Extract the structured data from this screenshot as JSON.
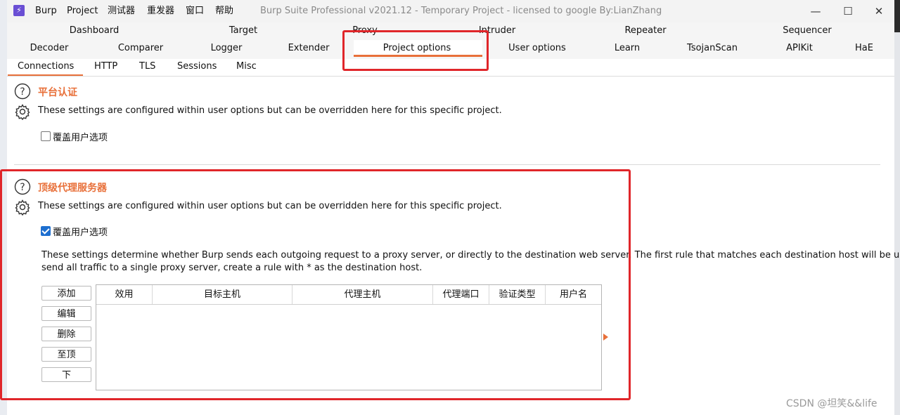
{
  "window": {
    "app_icon_glyph": "⚡",
    "menu": [
      "Burp",
      "Project",
      "测试器",
      "重发器",
      "窗口",
      "帮助"
    ],
    "title": "Burp Suite Professional v2021.12 - Temporary Project - licensed to google By:LianZhang",
    "controls": {
      "minimize": "—",
      "maximize": "☐",
      "close": "✕"
    }
  },
  "tabs_row1": [
    "Dashboard",
    "Target",
    "Proxy",
    "Intruder",
    "Repeater",
    "Sequencer"
  ],
  "tabs_row2": [
    "Decoder",
    "Comparer",
    "Logger",
    "Extender",
    "Project options",
    "User options",
    "Learn",
    "TsojanScan",
    "APIKit",
    "HaE"
  ],
  "active_tab": "Project options",
  "subtabs": [
    "Connections",
    "HTTP",
    "TLS",
    "Sessions",
    "Misc"
  ],
  "active_subtab": "Connections",
  "sections": {
    "platform_auth": {
      "title": "平台认证",
      "description": "These settings are configured within user options but can be overridden here for this specific project.",
      "override_label": "覆盖用户选项",
      "override_checked": false
    },
    "upstream_proxy": {
      "title": "顶级代理服务器",
      "description": "These settings are configured within user options but can be overridden here for this specific project.",
      "override_label": "覆盖用户选项",
      "override_checked": true,
      "long_description_line1": "These settings determine whether Burp sends each outgoing request to a proxy server, or directly to the destination web server. The first rule that matches each destination host will be used. To",
      "long_description_line2": "send all traffic to a single proxy server, create a rule with * as the destination host.",
      "buttons": [
        "添加",
        "编辑",
        "删除",
        "至顶",
        "下"
      ],
      "table_columns": [
        "效用",
        "目标主机",
        "代理主机",
        "代理端口",
        "验证类型",
        "用户名"
      ],
      "table_rows": []
    }
  },
  "icons": {
    "help": "help-icon",
    "settings": "gear-icon"
  },
  "colors": {
    "accent": "#e8703a",
    "highlight": "#e0262a",
    "checkbox": "#1e6fd0"
  },
  "watermark": "CSDN @坦笑&&life"
}
